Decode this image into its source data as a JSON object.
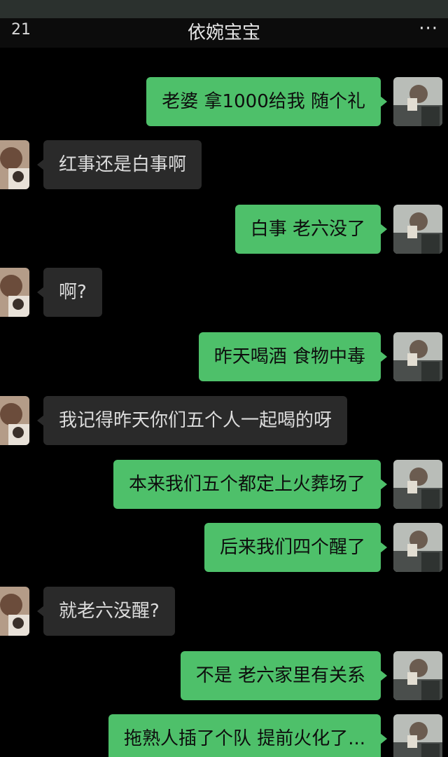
{
  "header": {
    "unread_count": "21",
    "title": "依婉宝宝",
    "more_glyph": "···"
  },
  "messages": [
    {
      "side": "out",
      "text": "老婆 拿1000给我 随个礼"
    },
    {
      "side": "in",
      "text": "红事还是白事啊"
    },
    {
      "side": "out",
      "text": "白事 老六没了"
    },
    {
      "side": "in",
      "text": "啊?"
    },
    {
      "side": "out",
      "text": "昨天喝酒 食物中毒"
    },
    {
      "side": "in",
      "text": "我记得昨天你们五个人一起喝的呀"
    },
    {
      "side": "out",
      "text": "本来我们五个都定上火葬场了"
    },
    {
      "side": "out",
      "text": "后来我们四个醒了"
    },
    {
      "side": "in",
      "text": "就老六没醒?"
    },
    {
      "side": "out",
      "text": "不是 老六家里有关系"
    },
    {
      "side": "out",
      "text": "拖熟人插了个队 提前火化了..."
    }
  ],
  "colors": {
    "outgoing_bubble": "#4ec06a",
    "incoming_bubble": "#2a2a2a",
    "background": "#000000"
  }
}
